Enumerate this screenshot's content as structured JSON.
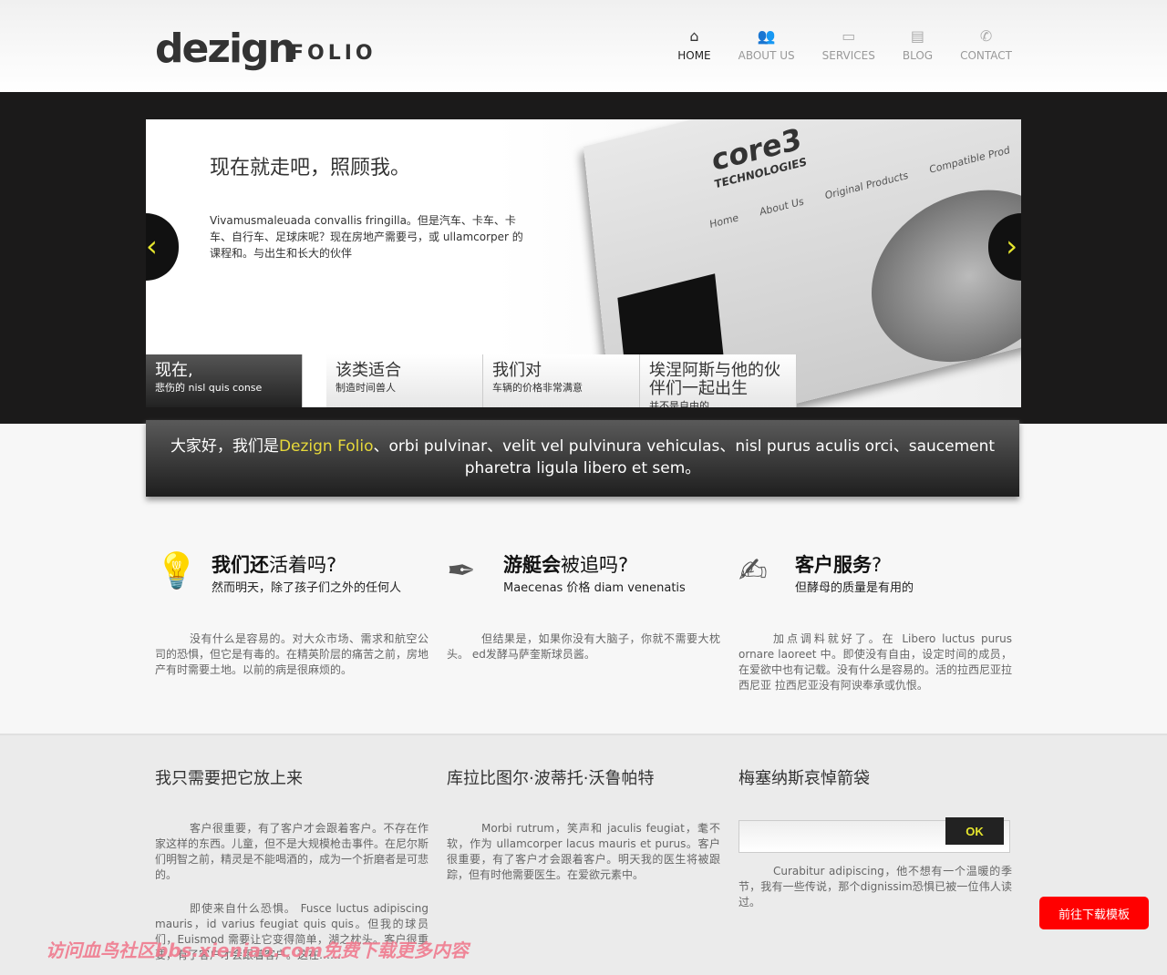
{
  "logo": {
    "word": "dezign",
    "sub": "FOLIO"
  },
  "nav": [
    {
      "label": "HOME",
      "icon": "home-icon",
      "glyph": "⌂"
    },
    {
      "label": "ABOUT US",
      "icon": "users-icon",
      "glyph": "👥"
    },
    {
      "label": "SERVICES",
      "icon": "monitor-icon",
      "glyph": "▭"
    },
    {
      "label": "BLOG",
      "icon": "newspaper-icon",
      "glyph": "▤"
    },
    {
      "label": "CONTACT",
      "icon": "phone-icon",
      "glyph": "✆"
    }
  ],
  "slider": {
    "title": "现在就走吧，照顾我。",
    "text": "Vivamusmaleuada convallis fringilla。但是汽车、卡车、卡车、自行车、足球床呢？现在房地产需要弓，或 ullamcorper 的课程和。与出生和长大的伙伴",
    "mock_brand": "core3",
    "mock_sub": "TECHNOLOGIES",
    "mock_links": [
      "Home",
      "About Us",
      "Original Products",
      "Compatible Prod"
    ],
    "tabs": [
      {
        "t1": "现在,",
        "t2": "悲伤的 nisl quis conse"
      },
      {
        "t1": "该类适合",
        "t2": "制造时间兽人"
      },
      {
        "t1": "我们对",
        "t2": "车辆的价格非常满意"
      },
      {
        "t1": "埃涅阿斯与他的伙伴们一起出生",
        "t2": "并不是自由的"
      }
    ],
    "prev": "‹",
    "next": "›"
  },
  "intro": {
    "pre": "大家好，我们是",
    "highlight": "Dezign Folio",
    "post": "、orbi pulvinar、velit vel pulvinura vehiculas、nisl purus aculis orci、saucement pharetra ligula libero et sem。"
  },
  "features": [
    {
      "icon": "lightbulb-icon",
      "bold": "我们还",
      "rest": "活着吗?",
      "sub": "然而明天，除了孩子们之外的任何人",
      "text": "没有什么是容易的。对大众市场、需求和航空公司的恐惧，但它是有毒的。在精英阶层的痛苦之前，房地产有时需要土地。以前的病是很麻烦的。"
    },
    {
      "icon": "pen-icon",
      "bold": "游艇会",
      "rest": "被追吗?",
      "sub": "Maecenas 价格 diam venenatis",
      "text": "但结果是，如果你没有大脑子，你就不需要大枕头。 ed发酵马萨奎斯球员酱。"
    },
    {
      "icon": "tablet-icon",
      "bold": "客户服务",
      "rest": "?",
      "sub": "但酵母的质量是有用的",
      "text": "加点调料就好了。在 Libero luctus purus ornare laoreet 中。即使没有自由，设定时间的成员，在爱欲中也有记载。没有什么是容易的。活的拉西尼亚拉西尼亚 拉西尼亚没有阿谀奉承或仇恨。"
    }
  ],
  "footer": {
    "col1": {
      "title": "我只需要把它放上来",
      "p1": "客户很重要，有了客户才会跟着客户。不存在作家这样的东西。儿童，但不是大规模枪击事件。在尼尔斯们明智之前，精灵是不能喝酒的，成为一个折磨者是可悲的。",
      "p2": "即使来自什么恐惧。 Fusce luctus adipiscing mauris，id varius feugiat quis quis。但我的球员们，Euismod 需要让它变得简单，湖之枕头。客户很重要，有了客户才会跟着客户。这在……"
    },
    "col2": {
      "title": "库拉比图尔·波蒂托·沃鲁帕特",
      "p1": "Morbi rutrum，笑声和 jaculis feugiat，耄不软，作为 ullamcorper lacus mauris et purus。客户很重要，有了客户才会跟着客户。明天我的医生将被跟踪，但有时他需要医生。在爱欲元素中。"
    },
    "col3": {
      "title": "梅塞纳斯哀悼箭袋",
      "ok": "OK",
      "newsletter_value": "",
      "p1": "Curabitur adipiscing，他不想有一个温暖的季节，我有一些传说，那个dignissim恐惧已被一位伟人读过。"
    }
  },
  "download_button": "前往下载模板",
  "watermark": "访问血鸟社区bbs.xieniao.com免费下载更多内容",
  "colors": {
    "accent": "#e6d83a",
    "dark": "#1b1a1a",
    "download": "#ff0000"
  }
}
